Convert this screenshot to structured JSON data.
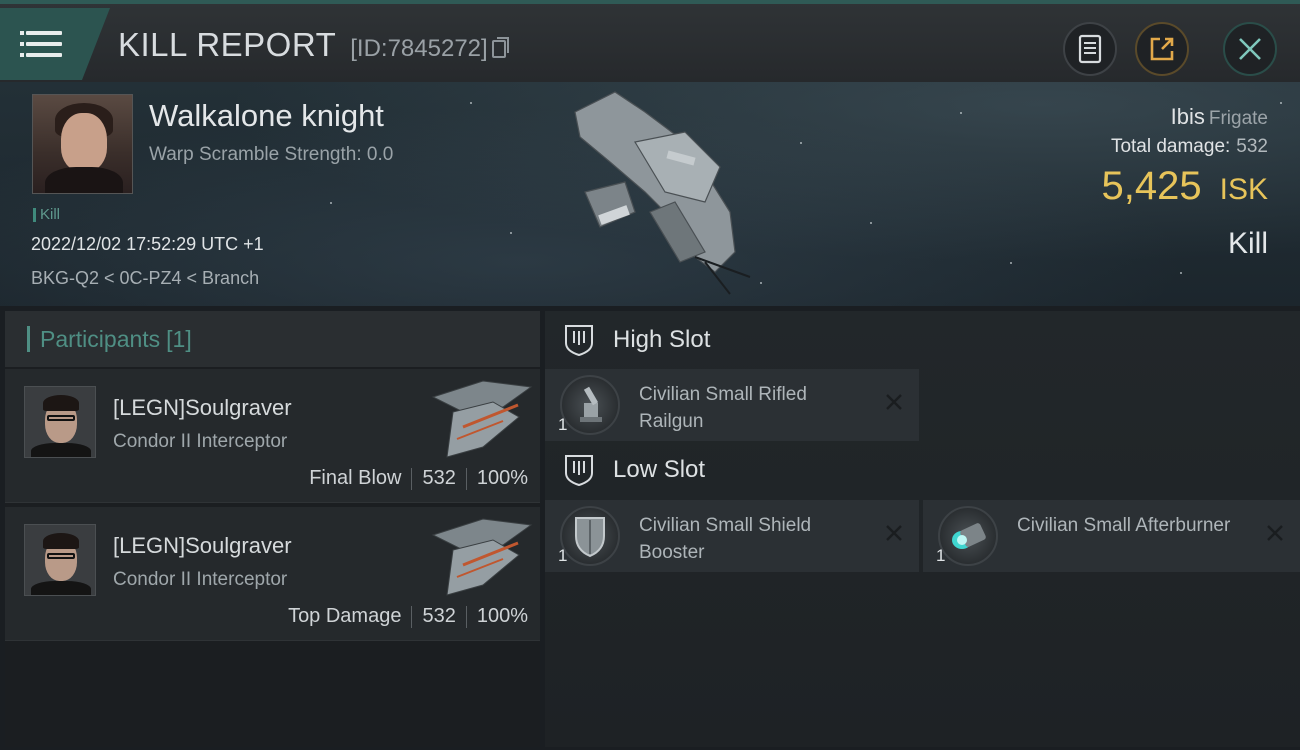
{
  "header": {
    "title": "KILL REPORT",
    "report_id": "[ID:7845272]",
    "colors": {
      "accent": "#2c5450",
      "isk": "#e7c45a"
    }
  },
  "victim": {
    "name": "Walkalone knight",
    "warp_scramble": "Warp Scramble Strength: 0.0",
    "tag": "Kill",
    "timestamp": "2022/12/02 17:52:29 UTC +1",
    "location": "BKG-Q2 < 0C-PZ4 < Branch"
  },
  "summary": {
    "ship": "Ibis",
    "ship_class": "Frigate",
    "total_damage_label": "Total damage:",
    "total_damage": "532",
    "isk_value": "5,425",
    "isk_unit": "ISK",
    "result": "Kill"
  },
  "participants": {
    "label": "Participants",
    "count": "[1]",
    "items": [
      {
        "name": "[LEGN]Soulgraver",
        "ship": "Condor II Interceptor",
        "role": "Final Blow",
        "damage": "532",
        "percent": "100%"
      },
      {
        "name": "[LEGN]Soulgraver",
        "ship": "Condor II Interceptor",
        "role": "Top Damage",
        "damage": "532",
        "percent": "100%"
      }
    ]
  },
  "fitting": {
    "high_slot_label": "High Slot",
    "low_slot_label": "Low Slot",
    "high": [
      {
        "name": "Civilian Small Rifled Railgun",
        "qty": "1",
        "icon": "railgun-icon"
      }
    ],
    "low": [
      {
        "name": "Civilian Small Shield Booster",
        "qty": "1",
        "icon": "shield-booster-icon"
      },
      {
        "name": "Civilian Small Afterburner",
        "qty": "1",
        "icon": "afterburner-icon"
      }
    ]
  }
}
